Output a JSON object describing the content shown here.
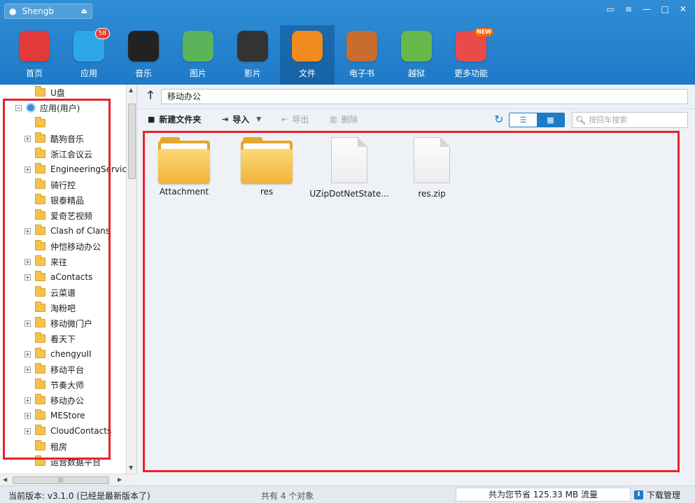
{
  "device": {
    "name": "Shengb",
    "apple_icon": "apple-icon",
    "eject_icon": "eject-icon"
  },
  "window_controls": [
    "feedback-icon",
    "menu-icon",
    "minimize-icon",
    "maximize-icon",
    "close-icon"
  ],
  "nav": [
    {
      "label": "首页",
      "icon": "store-icon",
      "color": "#e23a3a"
    },
    {
      "label": "应用",
      "icon": "app-store-icon",
      "color": "#2ea7e8",
      "badge": "58"
    },
    {
      "label": "音乐",
      "icon": "music-icon",
      "color": "#222222"
    },
    {
      "label": "图片",
      "icon": "photo-icon",
      "color": "#5bb45a"
    },
    {
      "label": "影片",
      "icon": "clapper-icon",
      "color": "#333333"
    },
    {
      "label": "文件",
      "icon": "folder-icon",
      "color": "#f28a1e",
      "active": true
    },
    {
      "label": "电子书",
      "icon": "book-icon",
      "color": "#c96d2e"
    },
    {
      "label": "越狱",
      "icon": "pineapple-icon",
      "color": "#66b84a"
    },
    {
      "label": "更多功能",
      "icon": "more-icon",
      "color": "#e94a4a",
      "badge_new": "NEW"
    }
  ],
  "tree": {
    "items": [
      {
        "label": "U盘",
        "type": "folder",
        "level": 1,
        "expander": false
      },
      {
        "label": "应用(用户)",
        "type": "app",
        "level": 0,
        "expander": "−"
      },
      {
        "label": "",
        "type": "folder",
        "level": 1,
        "expander": false
      },
      {
        "label": "酷狗音乐",
        "type": "folder",
        "level": 1,
        "expander": "+"
      },
      {
        "label": "浙江会议云",
        "type": "folder",
        "level": 1,
        "expander": false
      },
      {
        "label": "EngineeringService",
        "type": "folder",
        "level": 1,
        "expander": "+"
      },
      {
        "label": "骑行控",
        "type": "folder",
        "level": 1,
        "expander": false
      },
      {
        "label": "银泰精品",
        "type": "folder",
        "level": 1,
        "expander": false
      },
      {
        "label": "爱奇艺视频",
        "type": "folder",
        "level": 1,
        "expander": false
      },
      {
        "label": "Clash of Clans",
        "type": "folder",
        "level": 1,
        "expander": "+"
      },
      {
        "label": "仲恺移动办公",
        "type": "folder",
        "level": 1,
        "expander": false
      },
      {
        "label": "来往",
        "type": "folder",
        "level": 1,
        "expander": "+"
      },
      {
        "label": "aContacts",
        "type": "folder",
        "level": 1,
        "expander": "+"
      },
      {
        "label": "云菜谱",
        "type": "folder",
        "level": 1,
        "expander": false
      },
      {
        "label": "淘粉吧",
        "type": "folder",
        "level": 1,
        "expander": false
      },
      {
        "label": "移动微门户",
        "type": "folder",
        "level": 1,
        "expander": "+"
      },
      {
        "label": "看天下",
        "type": "folder",
        "level": 1,
        "expander": false
      },
      {
        "label": "chengyuII",
        "type": "folder",
        "level": 1,
        "expander": "+"
      },
      {
        "label": "移动平台",
        "type": "folder",
        "level": 1,
        "expander": "+"
      },
      {
        "label": "节奏大师",
        "type": "folder",
        "level": 1,
        "expander": false
      },
      {
        "label": "移动办公",
        "type": "folder",
        "level": 1,
        "expander": "+"
      },
      {
        "label": "MEStore",
        "type": "folder",
        "level": 1,
        "expander": "+"
      },
      {
        "label": "CloudContacts",
        "type": "folder",
        "level": 1,
        "expander": "+"
      },
      {
        "label": "租房",
        "type": "folder",
        "level": 1,
        "expander": false
      },
      {
        "label": "运营数据平台",
        "type": "folder",
        "level": 1,
        "expander": false
      }
    ]
  },
  "path": {
    "value": "移动办公"
  },
  "toolbar": {
    "new_folder": "新建文件夹",
    "import": "导入",
    "export": "导出",
    "delete": "删除",
    "search_placeholder": "按回车搜索"
  },
  "files": [
    {
      "name": "Attachment",
      "type": "folder"
    },
    {
      "name": "res",
      "type": "folder"
    },
    {
      "name": "UZipDotNetState...",
      "type": "file"
    },
    {
      "name": "res.zip",
      "type": "file"
    }
  ],
  "status": {
    "version": "当前版本: v3.1.0  (已经是最新版本了)",
    "count": "共有 4 个对象",
    "traffic": "共为您节省  125.33 MB 流量",
    "download": "下载管理"
  },
  "colors": {
    "accent": "#1f7ac7",
    "highlight_box": "#e8212a"
  }
}
